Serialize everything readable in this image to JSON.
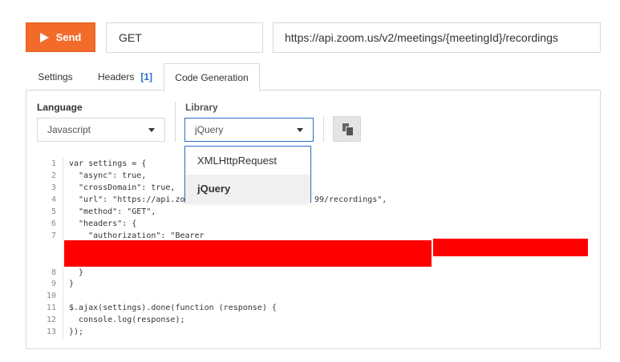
{
  "toolbar": {
    "send_label": "Send",
    "method": "GET",
    "url": "https://api.zoom.us/v2/meetings/{meetingId}/recordings"
  },
  "tabs": [
    {
      "label": "Settings"
    },
    {
      "label": "Headers",
      "badge": "[1]"
    },
    {
      "label": "Code Generation",
      "active": true
    }
  ],
  "codegen": {
    "language_label": "Language",
    "language_value": "Javascript",
    "library_label": "Library",
    "library_value": "jQuery",
    "dropdown_options": [
      "XMLHttpRequest",
      "jQuery"
    ],
    "selected_option": "jQuery"
  },
  "code": {
    "line_numbers": [
      "1",
      "2",
      "3",
      "4",
      "5",
      "6",
      "7",
      "8",
      "9",
      "10",
      "11",
      "12",
      "13"
    ],
    "lines": [
      "var settings = {",
      "  \"async\": true,",
      "  \"crossDomain\": true,",
      "  \"url\": \"https://api.zo",
      "  \"method\": \"GET\",",
      "  \"headers\": {",
      "    \"authorization\": \"Bearer",
      "  }",
      "}",
      "",
      "$.ajax(settings).done(function (response) {",
      "  console.log(response);",
      "});"
    ],
    "line4_tail": "99/recordings\",",
    "line3_tail": "true,"
  },
  "colors": {
    "accent": "#f26b2a",
    "link": "#2a6fc9",
    "redaction": "#ff0000"
  }
}
